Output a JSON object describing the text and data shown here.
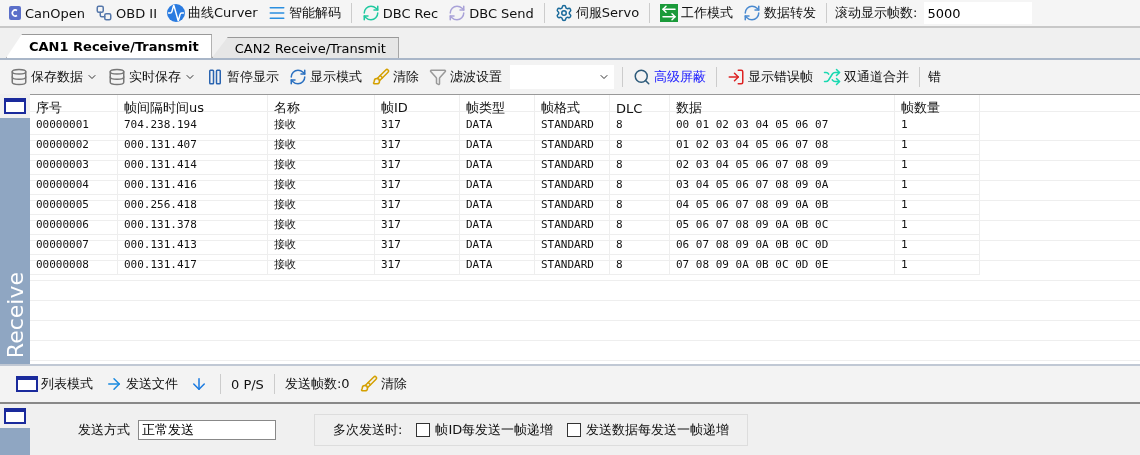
{
  "top_toolbar": {
    "items": [
      {
        "label": "CanOpen"
      },
      {
        "label": "OBD II"
      },
      {
        "label": "曲线Curver"
      },
      {
        "label": "智能解码"
      },
      {
        "label": "DBC Rec"
      },
      {
        "label": "DBC Send"
      },
      {
        "label": "伺服Servo"
      },
      {
        "label": "工作模式"
      },
      {
        "label": "数据转发"
      }
    ],
    "scroll_label": "滚动显示帧数:",
    "scroll_value": "5000"
  },
  "tabs": [
    {
      "label": "CAN1 Receive/Transmit",
      "selected": true
    },
    {
      "label": "CAN2 Receive/Transmit",
      "selected": false
    }
  ],
  "toolbar": [
    {
      "kind": "menu",
      "label": "保存数据"
    },
    {
      "kind": "menu",
      "label": "实时保存"
    },
    {
      "kind": "button",
      "label": "暂停显示"
    },
    {
      "kind": "button",
      "label": "显示模式"
    },
    {
      "kind": "button",
      "label": "清除"
    },
    {
      "kind": "button",
      "label": "滤波设置"
    },
    {
      "kind": "combo"
    },
    {
      "kind": "link",
      "label": "高级屏蔽"
    },
    {
      "kind": "button",
      "label": "显示错误帧"
    },
    {
      "kind": "button",
      "label": "双通道合并"
    },
    {
      "kind": "text",
      "label": "错"
    }
  ],
  "receive_panel": {
    "side_label": "Receive"
  },
  "table": {
    "columns": [
      "序号",
      "帧间隔时间us",
      "名称",
      "帧ID",
      "帧类型",
      "帧格式",
      "DLC",
      "数据",
      "帧数量"
    ],
    "rows": [
      [
        "00000001",
        "704.238.194",
        "接收",
        "317",
        "DATA",
        "STANDARD",
        "8",
        "00 01 02 03 04 05 06 07",
        "1"
      ],
      [
        "00000002",
        "000.131.407",
        "接收",
        "317",
        "DATA",
        "STANDARD",
        "8",
        "01 02 03 04 05 06 07 08",
        "1"
      ],
      [
        "00000003",
        "000.131.414",
        "接收",
        "317",
        "DATA",
        "STANDARD",
        "8",
        "02 03 04 05 06 07 08 09",
        "1"
      ],
      [
        "00000004",
        "000.131.416",
        "接收",
        "317",
        "DATA",
        "STANDARD",
        "8",
        "03 04 05 06 07 08 09 0A",
        "1"
      ],
      [
        "00000005",
        "000.256.418",
        "接收",
        "317",
        "DATA",
        "STANDARD",
        "8",
        "04 05 06 07 08 09 0A 0B",
        "1"
      ],
      [
        "00000006",
        "000.131.378",
        "接收",
        "317",
        "DATA",
        "STANDARD",
        "8",
        "05 06 07 08 09 0A 0B 0C",
        "1"
      ],
      [
        "00000007",
        "000.131.413",
        "接收",
        "317",
        "DATA",
        "STANDARD",
        "8",
        "06 07 08 09 0A 0B 0C 0D",
        "1"
      ],
      [
        "00000008",
        "000.131.417",
        "接收",
        "317",
        "DATA",
        "STANDARD",
        "8",
        "07 08 09 0A 0B 0C 0D 0E",
        "1"
      ]
    ]
  },
  "send_toolbar": [
    {
      "kind": "button",
      "label": "列表模式"
    },
    {
      "kind": "button",
      "label": "发送文件"
    },
    {
      "kind": "icon"
    },
    {
      "kind": "text",
      "label": "0 P/S"
    },
    {
      "kind": "text",
      "label": "发送帧数:0"
    },
    {
      "kind": "button",
      "label": "清除"
    }
  ],
  "send_panel": {
    "mode_label": "发送方式",
    "mode_value": "正常发送",
    "multi_label": "多次发送时:",
    "options": [
      {
        "label": "帧ID每发送一帧递增",
        "checked": false
      },
      {
        "label": "发送数据每发送一帧递增",
        "checked": false
      }
    ]
  }
}
